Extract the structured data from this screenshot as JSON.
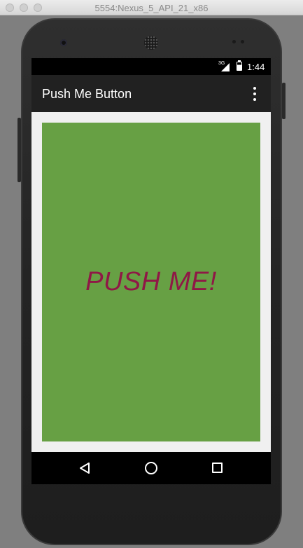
{
  "window": {
    "title": "5554:Nexus_5_API_21_x86"
  },
  "statusbar": {
    "network": "3G",
    "time": "1:44"
  },
  "appbar": {
    "title": "Push Me Button",
    "overflow_icon": "more-vert-icon"
  },
  "content": {
    "button_label": "PUSH ME!",
    "button_bg": "#67a044",
    "button_text_color": "#8f1846"
  },
  "navbar": {
    "back_icon": "back-icon",
    "home_icon": "home-icon",
    "recents_icon": "recents-icon"
  }
}
